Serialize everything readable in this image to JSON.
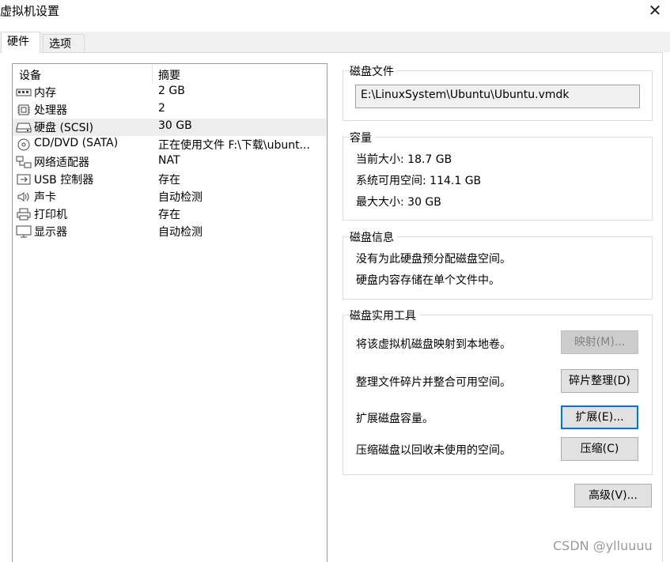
{
  "window": {
    "title": "虚拟机设置"
  },
  "tabs": [
    {
      "label": "硬件"
    },
    {
      "label": "选项"
    }
  ],
  "device_list": {
    "columns": [
      "设备",
      "摘要"
    ],
    "rows": [
      {
        "name": "内存",
        "summary": "2 GB",
        "icon": "memory-icon"
      },
      {
        "name": "处理器",
        "summary": "2",
        "icon": "cpu-icon"
      },
      {
        "name": "硬盘 (SCSI)",
        "summary": "30 GB",
        "icon": "harddisk-icon",
        "selected": true
      },
      {
        "name": "CD/DVD (SATA)",
        "summary": "正在使用文件 F:\\下载\\ubunt...",
        "icon": "cd-icon"
      },
      {
        "name": "网络适配器",
        "summary": "NAT",
        "icon": "network-icon"
      },
      {
        "name": "USB 控制器",
        "summary": "存在",
        "icon": "usb-icon"
      },
      {
        "name": "声卡",
        "summary": "自动检测",
        "icon": "speaker-icon"
      },
      {
        "name": "打印机",
        "summary": "存在",
        "icon": "printer-icon"
      },
      {
        "name": "显示器",
        "summary": "自动检测",
        "icon": "monitor-icon"
      }
    ]
  },
  "disk_file": {
    "title": "磁盘文件",
    "path": "E:\\LinuxSystem\\Ubuntu\\Ubuntu.vmdk"
  },
  "capacity": {
    "title": "容量",
    "current": "当前大小: 18.7 GB",
    "available": "系统可用空间: 114.1 GB",
    "max": "最大大小: 30 GB"
  },
  "disk_info": {
    "title": "磁盘信息",
    "line1": "没有为此硬盘预分配磁盘空间。",
    "line2": "硬盘内容存储在单个文件中。"
  },
  "utilities": {
    "title": "磁盘实用工具",
    "map_text": "将该虚拟机磁盘映射到本地卷。",
    "map_button": "映射(M)...",
    "defrag_text": "整理文件碎片并整合可用空间。",
    "defrag_button": "碎片整理(D)",
    "expand_text": "扩展磁盘容量。",
    "expand_button": "扩展(E)...",
    "compact_text": "压缩磁盘以回收未使用的空间。",
    "compact_button": "压缩(C)"
  },
  "advanced_button": "高级(V)...",
  "watermark": "CSDN @ylluuuu"
}
